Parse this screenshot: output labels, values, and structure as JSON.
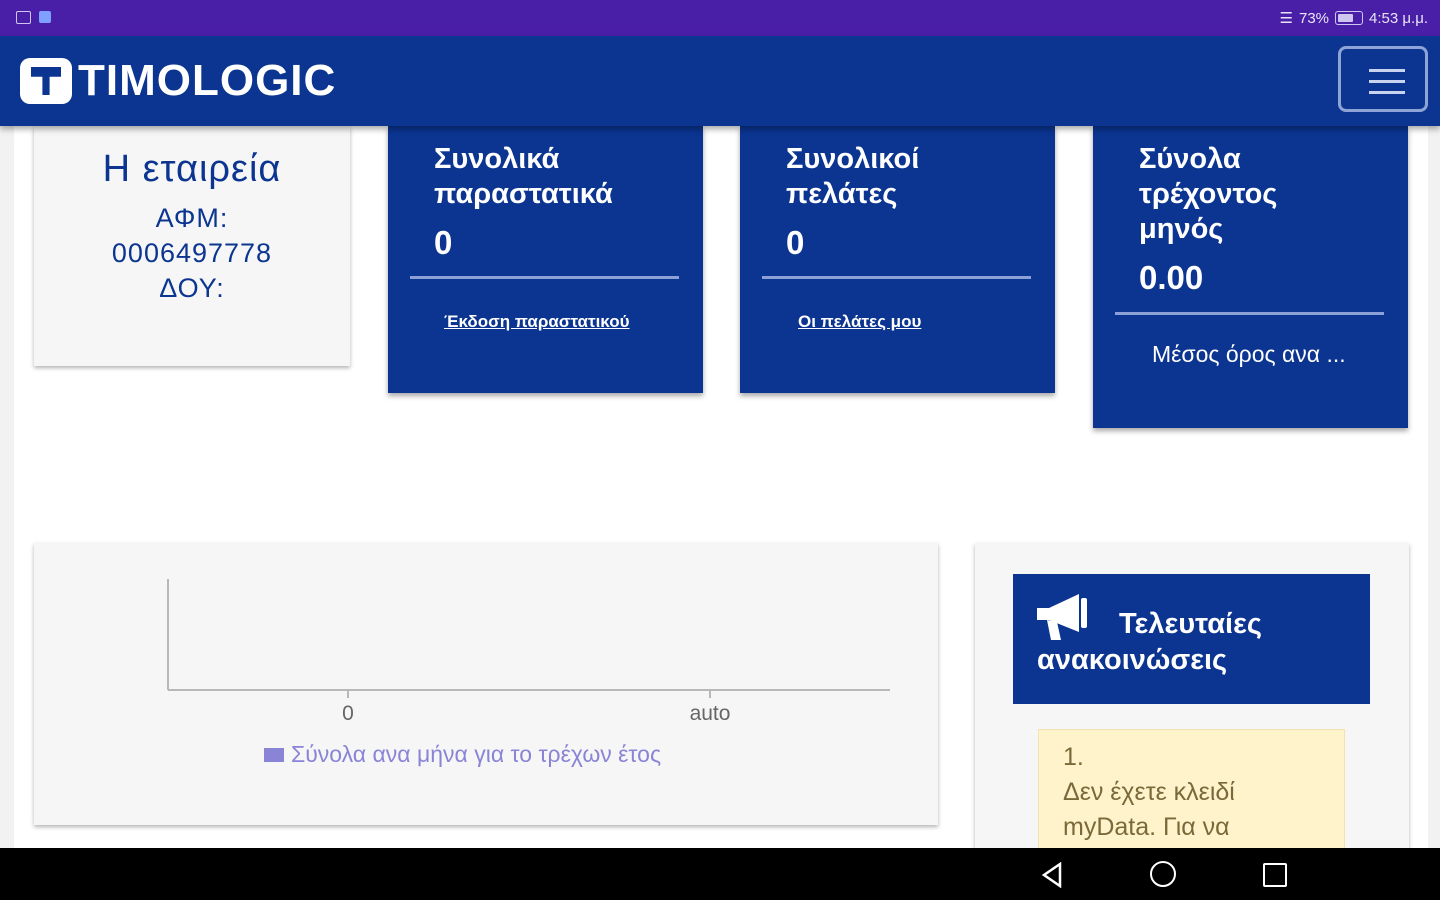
{
  "status_bar": {
    "battery_percent": "73%",
    "time": "4:53 μ.μ."
  },
  "app": {
    "logo_text": "TIMOLOGIC",
    "brand_color": "#0b3591"
  },
  "company": {
    "name": "Η εταιρεία",
    "afm_label": "ΑΦΜ:",
    "afm_value": "0006497778",
    "doy_label": "ΔΟΥ:"
  },
  "stats": [
    {
      "title_line1": "Συνολικά",
      "title_line2": "παραστατικά",
      "value": "0",
      "link": "Έκδοση παραστατικού"
    },
    {
      "title_line1": "Συνολικοί",
      "title_line2": "πελάτες",
      "value": "0",
      "link": "Οι πελάτες μου"
    },
    {
      "title_line1": "Σύνολα",
      "title_line2": "τρέχοντος",
      "title_line3": "μηνός",
      "value": "0.00",
      "link": "Μέσος όρος ανα ..."
    }
  ],
  "chart_data": {
    "type": "bar",
    "categories": [
      "0",
      "auto"
    ],
    "series": [
      {
        "name": "Σύνολα ανα μήνα για το τρέχων έτος",
        "values": []
      }
    ],
    "legend_position": "bottom",
    "series_color": "#8a84d6",
    "grid": false
  },
  "announcements": {
    "title_line1": "Τελευταίες",
    "title_line2": "ανακοινώσεις",
    "items": [
      {
        "number": "1.",
        "line1": "Δεν έχετε κλειδί",
        "line2": "myData. Για να"
      }
    ]
  }
}
